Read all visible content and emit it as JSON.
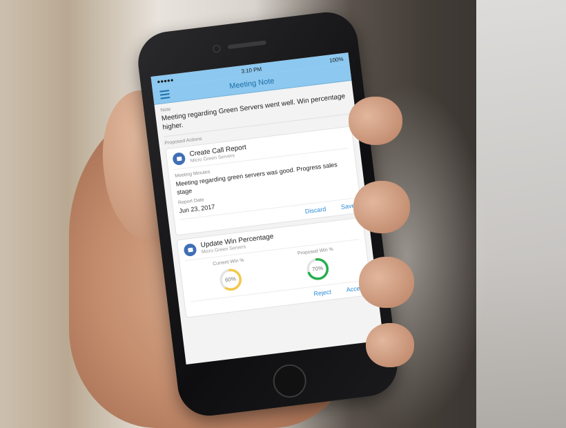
{
  "status_bar": {
    "signal": "●●●●● ",
    "time": "3:10 PM",
    "battery": "100%"
  },
  "nav": {
    "title": "Meeting Note"
  },
  "note": {
    "label": "Note",
    "text": "Meeting regarding Green Servers went well. Win percentage higher."
  },
  "proposed_actions": {
    "label": "Proposed Actions",
    "call_report": {
      "title": "Create Call Report",
      "subtitle": "Micro Green Servers",
      "minutes_label": "Meeting Minutes",
      "minutes_value": "Meeting regarding green servers was good. Progress sales stage",
      "date_label": "Report Date",
      "date_value": "Jun 23, 2017",
      "discard_label": "Discard",
      "save_label": "Save"
    },
    "win_percentage": {
      "title": "Update Win Percentage",
      "subtitle": "Micro Green Servers",
      "current_label": "Current Win %",
      "current_value": "60%",
      "current_fraction": 0.6,
      "proposed_label": "Proposed Win %",
      "proposed_value": "70%",
      "proposed_fraction": 0.7,
      "reject_label": "Reject",
      "accept_label": "Accept"
    }
  },
  "colors": {
    "nav_bg": "#8cc8ef",
    "accent": "#2a8ad6",
    "current_ring": "#f2c94c",
    "proposed_ring": "#27ae4f",
    "icon_bg": "#3f6fb5"
  }
}
